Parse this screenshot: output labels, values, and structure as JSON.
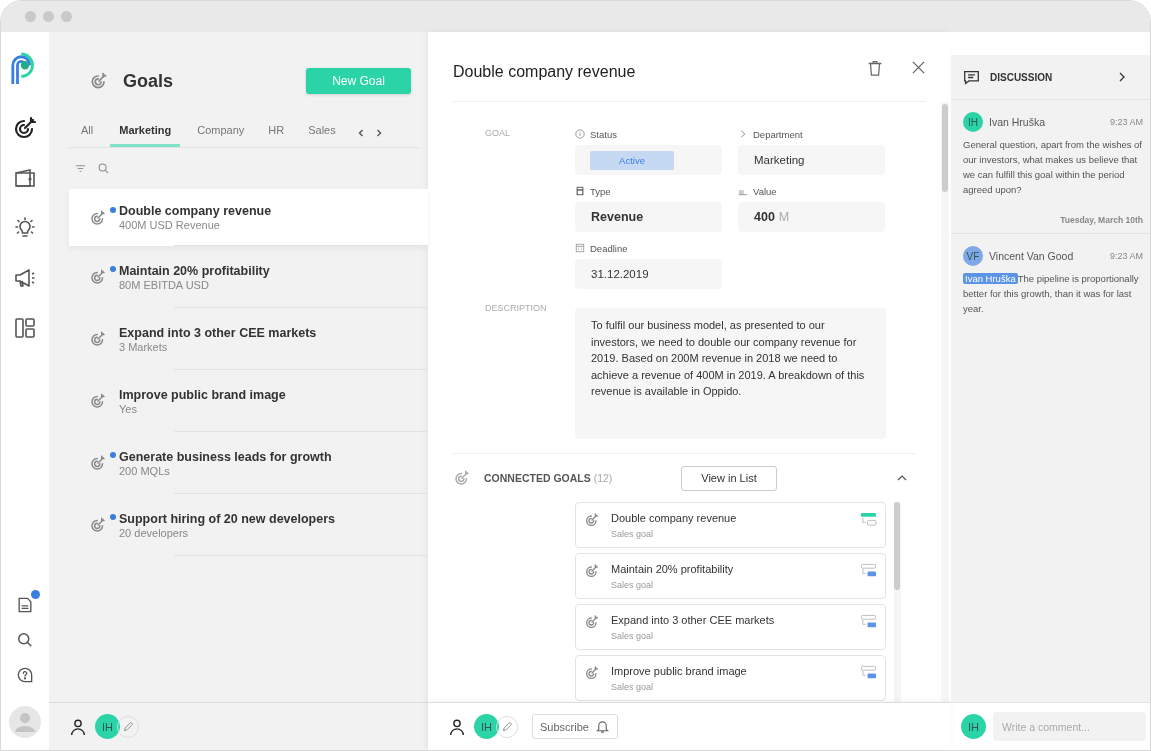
{
  "rail": {
    "top_items": [
      {
        "kind": "goals",
        "selected": true
      },
      {
        "kind": "wallet",
        "selected": false
      },
      {
        "kind": "idea",
        "selected": false
      },
      {
        "kind": "megaphone",
        "selected": false
      },
      {
        "kind": "dashboard",
        "selected": false
      }
    ],
    "bottom_items": [
      {
        "kind": "notes",
        "notification": true
      },
      {
        "kind": "search",
        "notification": false
      },
      {
        "kind": "help",
        "notification": false
      }
    ]
  },
  "goals_panel": {
    "title": "Goals",
    "new_button": "New Goal",
    "tabs": [
      {
        "label": "All",
        "selected": false
      },
      {
        "label": "Marketing",
        "selected": true
      },
      {
        "label": "Company",
        "selected": false
      },
      {
        "label": "HR",
        "selected": false
      },
      {
        "label": "Sales",
        "selected": false
      }
    ],
    "items": [
      {
        "title": "Double company revenue",
        "subtitle": "400M USD Revenue",
        "unread": true,
        "selected": true
      },
      {
        "title": "Maintain 20% profitability",
        "subtitle": "80M EBITDA USD",
        "unread": true,
        "selected": false
      },
      {
        "title": "Expand into 3 other CEE markets",
        "subtitle": "3 Markets",
        "unread": false,
        "selected": false
      },
      {
        "title": "Improve public brand image",
        "subtitle": "Yes",
        "unread": false,
        "selected": false
      },
      {
        "title": "Generate business leads for growth",
        "subtitle": "200 MQLs",
        "unread": true,
        "selected": false
      },
      {
        "title": "Support hiring of 20 new developers",
        "subtitle": "20 developers",
        "unread": true,
        "selected": false
      }
    ],
    "footer": {
      "avatar": "IH"
    }
  },
  "detail": {
    "title": "Double company revenue",
    "goal_label": "GOAL",
    "fields": [
      {
        "kind": "status",
        "label": "Status",
        "value": "Active"
      },
      {
        "kind": "department",
        "label": "Department",
        "value": "Marketing"
      },
      {
        "kind": "type",
        "label": "Type",
        "value": "Revenue"
      },
      {
        "kind": "value",
        "label": "Value",
        "value": "400",
        "unit": "M"
      },
      {
        "kind": "deadline",
        "label": "Deadline",
        "value": "31.12.2019"
      }
    ],
    "description_label": "DESCRIPTION",
    "description": "To fulfil our business model, as presented to our investors, we need to double our company revenue for 2019. Based on 200M revenue in 2018 we need to achieve a revenue of 400M in 2019. A breakdown of this revenue is available in Oppido.",
    "connected": {
      "label": "CONNECTED GOALS",
      "count": "(12)",
      "view_button": "View in List",
      "expanded": true,
      "items": [
        {
          "title": "Double company revenue",
          "subtitle": "Sales goal",
          "kind": "parent"
        },
        {
          "title": "Maintain 20% profitability",
          "subtitle": "Sales goal",
          "kind": "child"
        },
        {
          "title": "Expand into 3 other CEE markets",
          "subtitle": "Sales goal",
          "kind": "child"
        },
        {
          "title": "Improve public brand image",
          "subtitle": "Sales goal",
          "kind": "child"
        }
      ]
    },
    "footer": {
      "avatar": "IH",
      "subscribe_button": "Subscribe"
    }
  },
  "discussion": {
    "title": "DISCUSSION",
    "thread": [
      {
        "kind": "comment",
        "initials": "IH",
        "color": "#2ad4a7",
        "author": "Ivan Hruška",
        "time": "9:23 AM",
        "text": "General question, apart from the wishes of our investors, what makes us believe that we can fulfill this goal within the period agreed upon?"
      },
      {
        "kind": "date",
        "text": "Tuesday, March 10th"
      },
      {
        "kind": "comment",
        "initials": "VF",
        "color": "#7fa9e6",
        "author": "Vincent Van Good",
        "time": "9:23 AM",
        "mention": "Ivan Hruška",
        "text": "The pipeline is proportionally better for this growth, than it was for last year."
      }
    ],
    "composer": {
      "avatar": "IH",
      "placeholder": "Write a comment..."
    }
  }
}
